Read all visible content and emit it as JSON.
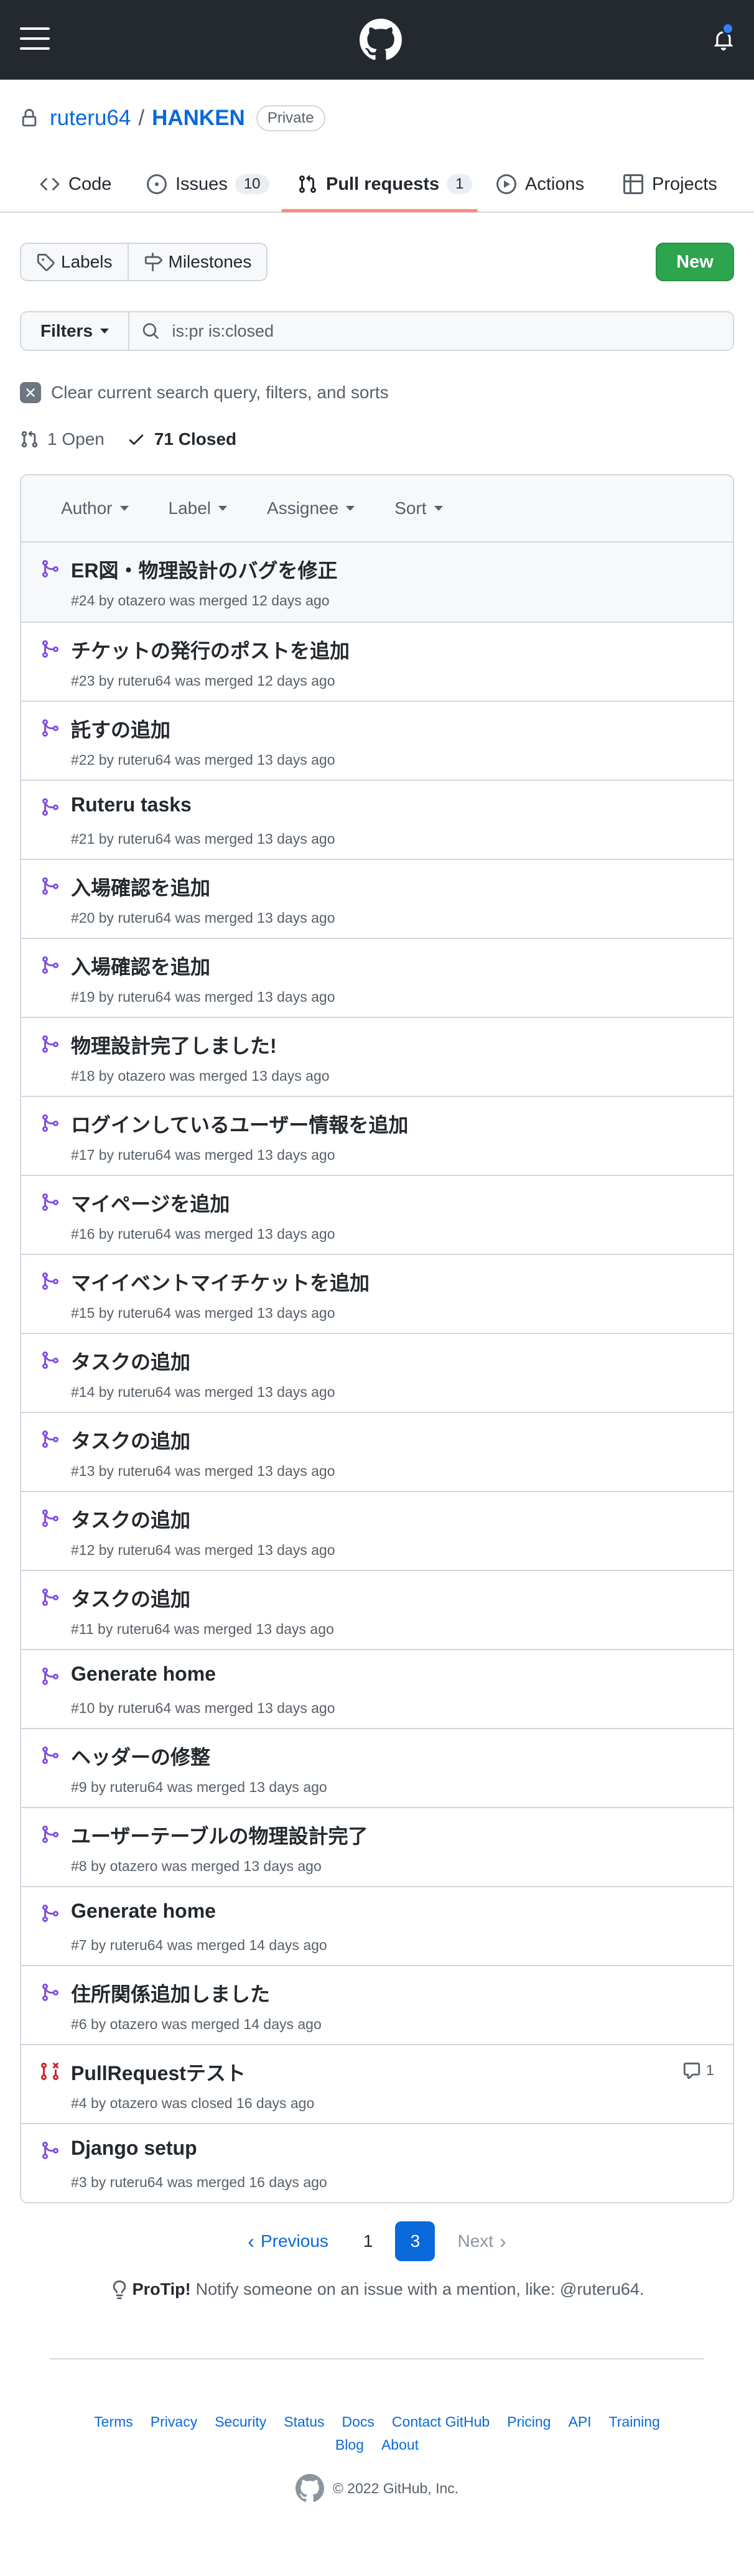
{
  "repo": {
    "owner": "ruteru64",
    "separator": "/",
    "name": "HANKEN",
    "visibility": "Private"
  },
  "tabs": [
    {
      "label": "Code",
      "icon": "code-icon"
    },
    {
      "label": "Issues",
      "count": "10",
      "icon": "issue-icon"
    },
    {
      "label": "Pull requests",
      "count": "1",
      "icon": "pull-request-icon",
      "active": true
    },
    {
      "label": "Actions",
      "icon": "play-icon"
    },
    {
      "label": "Projects",
      "icon": "table-icon"
    }
  ],
  "toolbar": {
    "labels": "Labels",
    "milestones": "Milestones",
    "new": "New"
  },
  "filter": {
    "button": "Filters",
    "query": "is:pr is:closed"
  },
  "clear_text": "Clear current search query, filters, and sorts",
  "states": {
    "open": "1 Open",
    "closed": "71 Closed"
  },
  "sorts": [
    "Author",
    "Label",
    "Assignee",
    "Sort"
  ],
  "pulls": [
    {
      "title": "ER図・物理設計のバグを修正",
      "meta": "#24 by otazero was merged 12 days ago",
      "state": "merged"
    },
    {
      "title": "チケットの発行のポストを追加",
      "meta": "#23 by ruteru64 was merged 12 days ago",
      "state": "merged"
    },
    {
      "title": "託すの追加",
      "meta": "#22 by ruteru64 was merged 13 days ago",
      "state": "merged"
    },
    {
      "title": "Ruteru tasks",
      "meta": "#21 by ruteru64 was merged 13 days ago",
      "state": "merged"
    },
    {
      "title": "入場確認を追加",
      "meta": "#20 by ruteru64 was merged 13 days ago",
      "state": "merged"
    },
    {
      "title": "入場確認を追加",
      "meta": "#19 by ruteru64 was merged 13 days ago",
      "state": "merged"
    },
    {
      "title": "物理設計完了しました!",
      "meta": "#18 by otazero was merged 13 days ago",
      "state": "merged"
    },
    {
      "title": "ログインしているユーザー情報を追加",
      "meta": "#17 by ruteru64 was merged 13 days ago",
      "state": "merged"
    },
    {
      "title": "マイページを追加",
      "meta": "#16 by ruteru64 was merged 13 days ago",
      "state": "merged"
    },
    {
      "title": "マイイベントマイチケットを追加",
      "meta": "#15 by ruteru64 was merged 13 days ago",
      "state": "merged"
    },
    {
      "title": "タスクの追加",
      "meta": "#14 by ruteru64 was merged 13 days ago",
      "state": "merged"
    },
    {
      "title": "タスクの追加",
      "meta": "#13 by ruteru64 was merged 13 days ago",
      "state": "merged"
    },
    {
      "title": "タスクの追加",
      "meta": "#12 by ruteru64 was merged 13 days ago",
      "state": "merged"
    },
    {
      "title": "タスクの追加",
      "meta": "#11 by ruteru64 was merged 13 days ago",
      "state": "merged"
    },
    {
      "title": "Generate home",
      "meta": "#10 by ruteru64 was merged 13 days ago",
      "state": "merged"
    },
    {
      "title": "ヘッダーの修整",
      "meta": "#9 by ruteru64 was merged 13 days ago",
      "state": "merged"
    },
    {
      "title": "ユーザーテーブルの物理設計完了",
      "meta": "#8 by otazero was merged 13 days ago",
      "state": "merged"
    },
    {
      "title": "Generate home",
      "meta": "#7 by ruteru64 was merged 14 days ago",
      "state": "merged"
    },
    {
      "title": "住所関係追加しました",
      "meta": "#6 by otazero was merged 14 days ago",
      "state": "merged"
    },
    {
      "title": "PullRequestテスト",
      "meta": "#4 by otazero was closed 16 days ago",
      "state": "closed",
      "comments": "1"
    },
    {
      "title": "Django setup",
      "meta": "#3 by ruteru64 was merged 16 days ago",
      "state": "merged"
    }
  ],
  "pagination": {
    "previous": "Previous",
    "pages": [
      "1",
      "3"
    ],
    "current": "3",
    "next": "Next"
  },
  "protip": {
    "label": "ProTip!",
    "text": "Notify someone on an issue with a mention, like: @ruteru64."
  },
  "footer": {
    "links": [
      "Terms",
      "Privacy",
      "Security",
      "Status",
      "Docs",
      "Contact GitHub",
      "Pricing",
      "API",
      "Training",
      "Blog",
      "About"
    ],
    "copyright": "© 2022 GitHub, Inc."
  },
  "colors": {
    "merged": "#8250df",
    "closed": "#cf222e",
    "accent": "#0969da",
    "new_button": "#2da44e",
    "header": "#24292f",
    "tab_underline": "#fd8c73"
  }
}
